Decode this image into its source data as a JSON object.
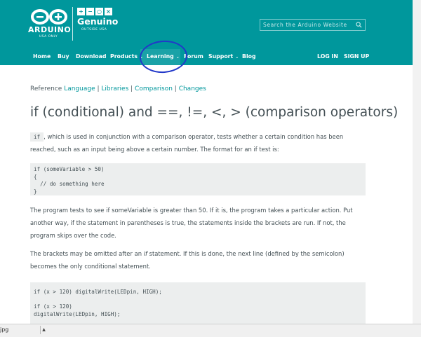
{
  "header": {
    "brand": "ARDUINO",
    "brand_sub": "USA ONLY",
    "genuino": "Genuino",
    "genuino_sub": "OUTSIDE USA",
    "genuino_icons": [
      "+",
      "−",
      "○",
      "×"
    ]
  },
  "search": {
    "placeholder": "Search the Arduino Website"
  },
  "nav": {
    "home": "Home",
    "buy": "Buy",
    "download": "Download",
    "products": "Products",
    "learning": "Learning",
    "forum": "Forum",
    "support": "Support",
    "blog": "Blog",
    "login": "LOG IN",
    "signup": "SIGN UP",
    "caret": "⌄"
  },
  "breadcrumb": {
    "reference": "Reference",
    "language": "Language",
    "libraries": "Libraries",
    "comparison": "Comparison",
    "changes": "Changes",
    "sep": " | "
  },
  "page": {
    "title": "if (conditional) and ==, !=, <, > (comparison operators)",
    "intro_code": "if",
    "intro_text": ", which is used in conjunction with a comparison operator, tests whether a certain condition has been reached, such as an input being above a certain number. The format for an if test is:",
    "code1": "if (someVariable > 50)\n{\n  // do something here\n}",
    "para2": "The program tests to see if someVariable is greater than 50. If it is, the program takes a particular action. Put another way, if the statement in parentheses is true, the statements inside the brackets are run. If not, the program skips over the code.",
    "para3_a": "The brackets may be omitted after an ",
    "para3_em": "if",
    "para3_b": " statement. If this is done, the next line (defined by the semicolon) becomes the only conditional statement.",
    "code2": "if (x > 120) digitalWrite(LEDpin, HIGH);\n\nif (x > 120)\ndigitalWrite(LEDpin, HIGH);"
  },
  "statusbar": {
    "file": "jpg",
    "drop": "▲"
  },
  "colors": {
    "teal": "#00979c",
    "text": "#434f54",
    "code_bg": "#eceeee",
    "annotation": "#2238c9"
  }
}
